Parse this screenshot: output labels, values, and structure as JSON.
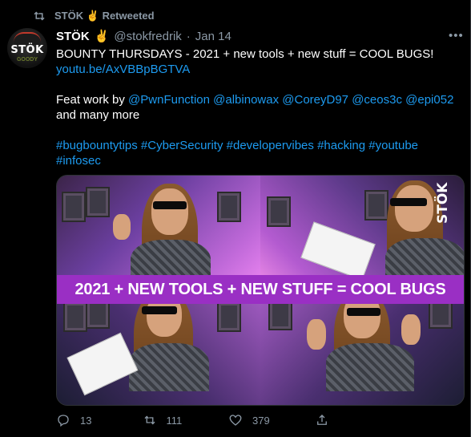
{
  "retweet": {
    "user": "STÖK",
    "emoji": "✌️",
    "label": "Retweeted"
  },
  "tweet": {
    "name": "STÖK",
    "emoji": "✌️",
    "handle": "@stokfredrik",
    "separator": "·",
    "date": "Jan 14",
    "more": "•••",
    "avatar": {
      "text": "STÖK",
      "sub": "GOODY"
    },
    "lines": {
      "l1": "BOUNTY THURSDAYS - 2021 + new tools + new stuff = COOL BUGS!",
      "link": "youtu.be/AxVBBpBGTVA",
      "feat_prefix": "Feat work by ",
      "mentions": [
        "@PwnFunction",
        "@albinowax",
        "@CoreyD97",
        "@ceos3c",
        "@epi052"
      ],
      "feat_suffix": "and many more",
      "hashtags_row1": [
        "#bugbountytips",
        "#CyberSecurity",
        "#developervibes",
        "#hacking",
        "#youtube"
      ],
      "hashtags_row2": [
        "#infosec"
      ]
    },
    "media": {
      "banner_text": "2021 + NEW TOOLS + NEW STUFF = COOL BUGS",
      "watermark": "STÖK"
    },
    "actions": {
      "reply_count": "13",
      "retweet_count": "111",
      "like_count": "379"
    }
  },
  "icons": [
    "retweet-icon",
    "reply-icon",
    "like-icon",
    "share-icon",
    "more-icon"
  ],
  "colors": {
    "background": "#000000",
    "link": "#1d9bf0",
    "muted": "#8b98a5",
    "banner": "#9a2fc4"
  }
}
